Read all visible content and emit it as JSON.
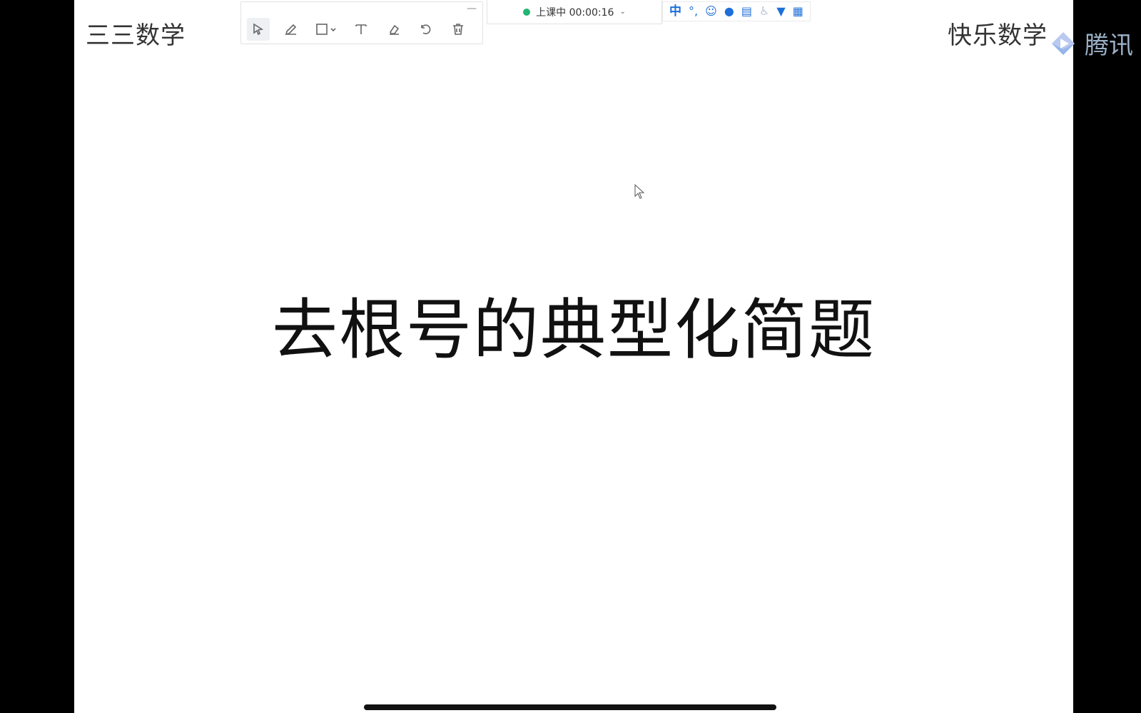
{
  "slide": {
    "corner_left": "三三数学",
    "corner_right": "快乐数学",
    "title": "去根号的典型化简题"
  },
  "toolbar": {
    "minimize": "—",
    "tools": [
      "select-icon",
      "pen-icon",
      "rectangle-icon",
      "text-icon",
      "eraser-icon",
      "undo-icon",
      "trash-icon"
    ]
  },
  "status": {
    "label": "上课中 00:00:16",
    "indicator_color": "#22b573"
  },
  "tray": {
    "ime": "中",
    "items": [
      "punctuation-icon",
      "emoji-icon",
      "microphone-icon",
      "keyboard-icon",
      "accessibility-icon",
      "skin-icon",
      "grid-icon"
    ]
  },
  "brand": {
    "name": "腾讯",
    "color": "#9bb1c7"
  }
}
